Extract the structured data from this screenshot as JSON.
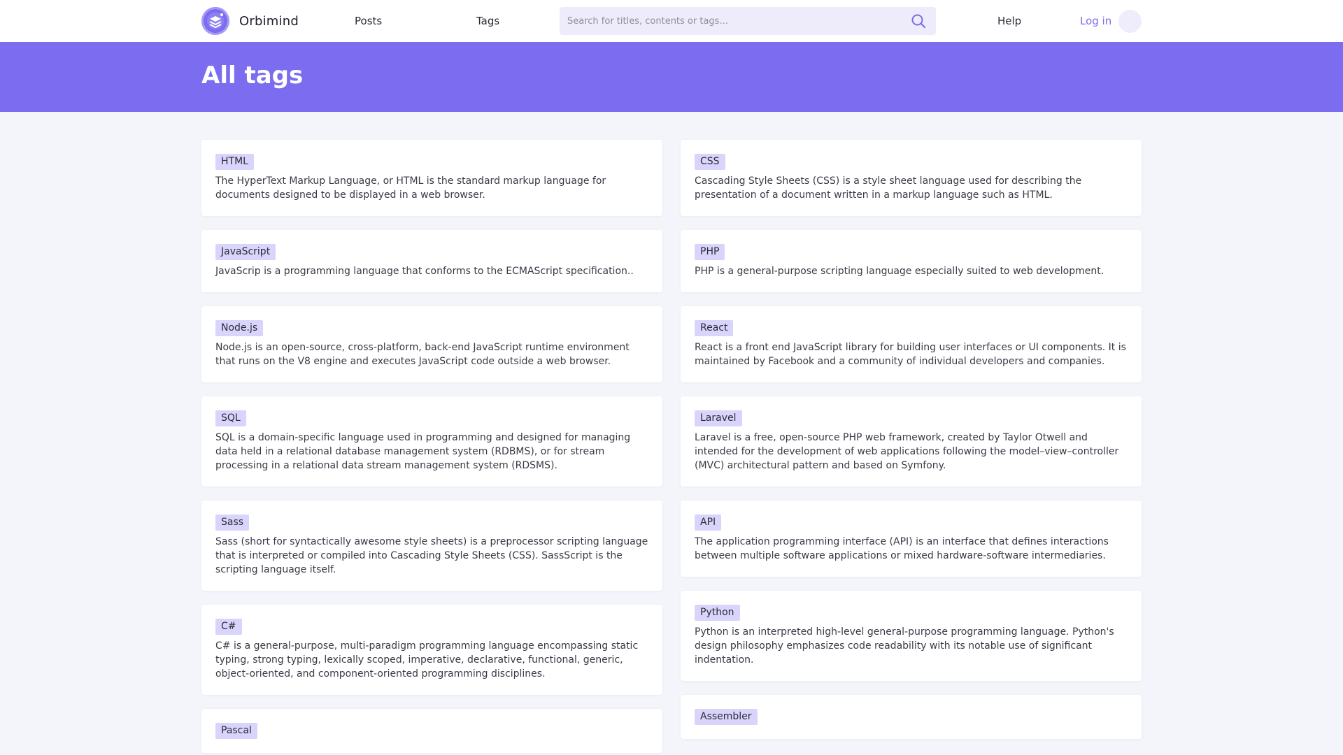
{
  "nav": {
    "brand": "Orbimind",
    "posts": "Posts",
    "tags": "Tags",
    "search_placeholder": "Search for titles, contents or tags...",
    "help": "Help",
    "login": "Log in"
  },
  "page": {
    "title": "All tags"
  },
  "colors": {
    "accent": "#7b6cf0",
    "tag_bg": "#d9d4fb",
    "page_bg": "#f3f5fb"
  },
  "tags_left": [
    {
      "name": "HTML",
      "description": "The HyperText Markup Language, or HTML is the standard markup language for documents designed to be displayed in a web browser."
    },
    {
      "name": "JavaScript",
      "description": "JavaScrip is a programming language that conforms to the ECMAScript specification.."
    },
    {
      "name": "Node.js",
      "description": "Node.js is an open-source, cross-platform, back-end JavaScript runtime environment that runs on the V8 engine and executes JavaScript code outside a web browser."
    },
    {
      "name": "SQL",
      "description": "SQL is a domain-specific language used in programming and designed for managing data held in a relational database management system (RDBMS), or for stream processing in a relational data stream management system (RDSMS)."
    },
    {
      "name": "Sass",
      "description": "Sass (short for syntactically awesome style sheets) is a preprocessor scripting language that is interpreted or compiled into Cascading Style Sheets (CSS). SassScript is the scripting language itself."
    },
    {
      "name": "C#",
      "description": "C# is a general-purpose, multi-paradigm programming language encompassing static typing, strong typing, lexically scoped, imperative, declarative, functional, generic, object-oriented, and component-oriented programming disciplines."
    },
    {
      "name": "Pascal",
      "description": ""
    }
  ],
  "tags_right": [
    {
      "name": "CSS",
      "description": "Cascading Style Sheets (CSS) is a style sheet language used for describing the presentation of a document written in a markup language such as HTML."
    },
    {
      "name": "PHP",
      "description": "PHP is a general-purpose scripting language especially suited to web development."
    },
    {
      "name": "React",
      "description": "React is a front end JavaScript library for building user interfaces or UI components. It is maintained by Facebook and a community of individual developers and companies."
    },
    {
      "name": "Laravel",
      "description": "Laravel is a free, open-source PHP web framework, created by Taylor Otwell and intended for the development of web applications following the model–view–controller (MVC) architectural pattern and based on Symfony."
    },
    {
      "name": "API",
      "description": "The application programming interface (API) is an interface that defines interactions between multiple software applications or mixed hardware-software intermediaries."
    },
    {
      "name": "Python",
      "description": "Python is an interpreted high-level general-purpose programming language. Python's design philosophy emphasizes code readability with its notable use of significant indentation."
    },
    {
      "name": "Assembler",
      "description": ""
    }
  ]
}
